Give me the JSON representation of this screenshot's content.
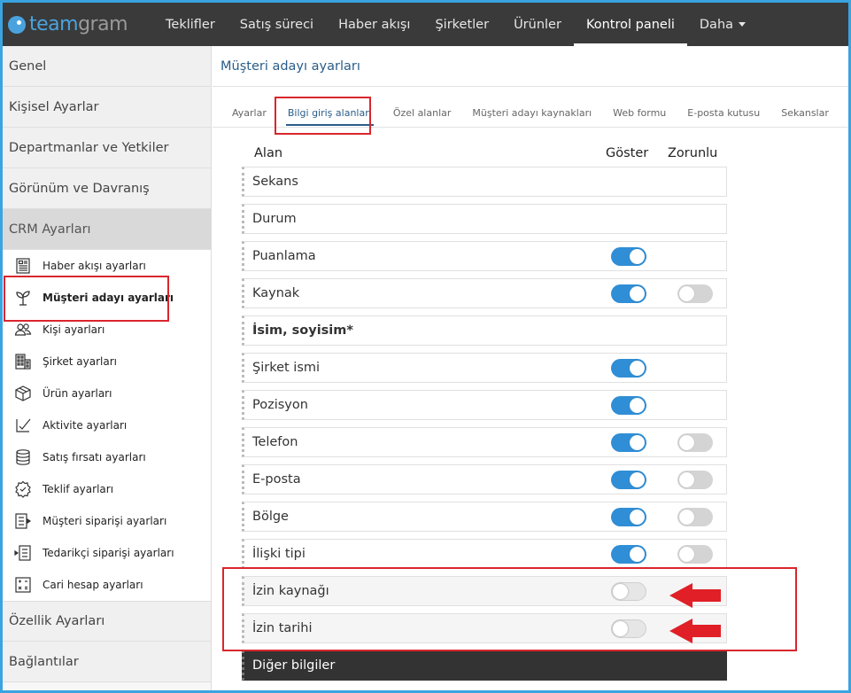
{
  "nav": {
    "logo_part1": "team",
    "logo_part2": "gram",
    "items": [
      {
        "label": "Teklifler"
      },
      {
        "label": "Satış süreci"
      },
      {
        "label": "Haber akışı"
      },
      {
        "label": "Şirketler"
      },
      {
        "label": "Ürünler"
      },
      {
        "label": "Kontrol paneli",
        "active": true
      },
      {
        "label": "Daha"
      }
    ]
  },
  "sidebar": {
    "sections_top": [
      "Genel",
      "Kişisel Ayarlar",
      "Departmanlar ve Yetkiler",
      "Görünüm ve Davranış",
      "CRM Ayarları"
    ],
    "sub_items": [
      {
        "label": "Haber akışı ayarları",
        "icon": "newsfeed-icon"
      },
      {
        "label": "Müşteri adayı ayarları",
        "icon": "sprout-icon",
        "active": true
      },
      {
        "label": "Kişi ayarları",
        "icon": "people-icon"
      },
      {
        "label": "Şirket ayarları",
        "icon": "building-icon"
      },
      {
        "label": "Ürün ayarları",
        "icon": "box-icon"
      },
      {
        "label": "Aktivite ayarları",
        "icon": "checkmark-icon"
      },
      {
        "label": "Satış fırsatı ayarları",
        "icon": "database-icon"
      },
      {
        "label": "Teklif ayarları",
        "icon": "badge-icon"
      },
      {
        "label": "Müşteri siparişi ayarları",
        "icon": "order-out-icon"
      },
      {
        "label": "Tedarikçi siparişi ayarları",
        "icon": "order-in-icon"
      },
      {
        "label": "Cari hesap ayarları",
        "icon": "calculator-icon"
      }
    ],
    "sections_bottom": [
      "Özellik Ayarları",
      "Bağlantılar"
    ]
  },
  "main": {
    "title": "Müşteri adayı ayarları",
    "tabs": [
      {
        "label": "Ayarlar"
      },
      {
        "label": "Bilgi giriş alanları",
        "active": true
      },
      {
        "label": "Özel alanlar"
      },
      {
        "label": "Müşteri adayı kaynakları"
      },
      {
        "label": "Web formu"
      },
      {
        "label": "E-posta kutusu"
      },
      {
        "label": "Sekanslar"
      }
    ],
    "columns": {
      "field": "Alan",
      "show": "Göster",
      "required": "Zorunlu"
    },
    "rows": [
      {
        "label": "Sekans",
        "show": null,
        "required": null
      },
      {
        "label": "Durum",
        "show": null,
        "required": null
      },
      {
        "label": "Puanlama",
        "show": true,
        "required": null
      },
      {
        "label": "Kaynak",
        "show": true,
        "required": false
      },
      {
        "label": "İsim, soyisim*",
        "show": null,
        "required": null,
        "bold": true
      },
      {
        "label": "Şirket ismi",
        "show": true,
        "required": null
      },
      {
        "label": "Pozisyon",
        "show": true,
        "required": null
      },
      {
        "label": "Telefon",
        "show": true,
        "required": false
      },
      {
        "label": "E-posta",
        "show": true,
        "required": false
      },
      {
        "label": "Bölge",
        "show": true,
        "required": false
      },
      {
        "label": "İlişki tipi",
        "show": true,
        "required": false
      },
      {
        "label": "İzin kaynağı",
        "show": false,
        "required": null,
        "highlight": true
      },
      {
        "label": "İzin tarihi",
        "show": false,
        "required": null,
        "highlight": true
      }
    ],
    "group_header": "Diğer bilgiler"
  },
  "colors": {
    "nav_bg": "#3a3a3a",
    "accent": "#2f8ed6",
    "title": "#2a5d8a",
    "highlight": "#d9262d"
  }
}
